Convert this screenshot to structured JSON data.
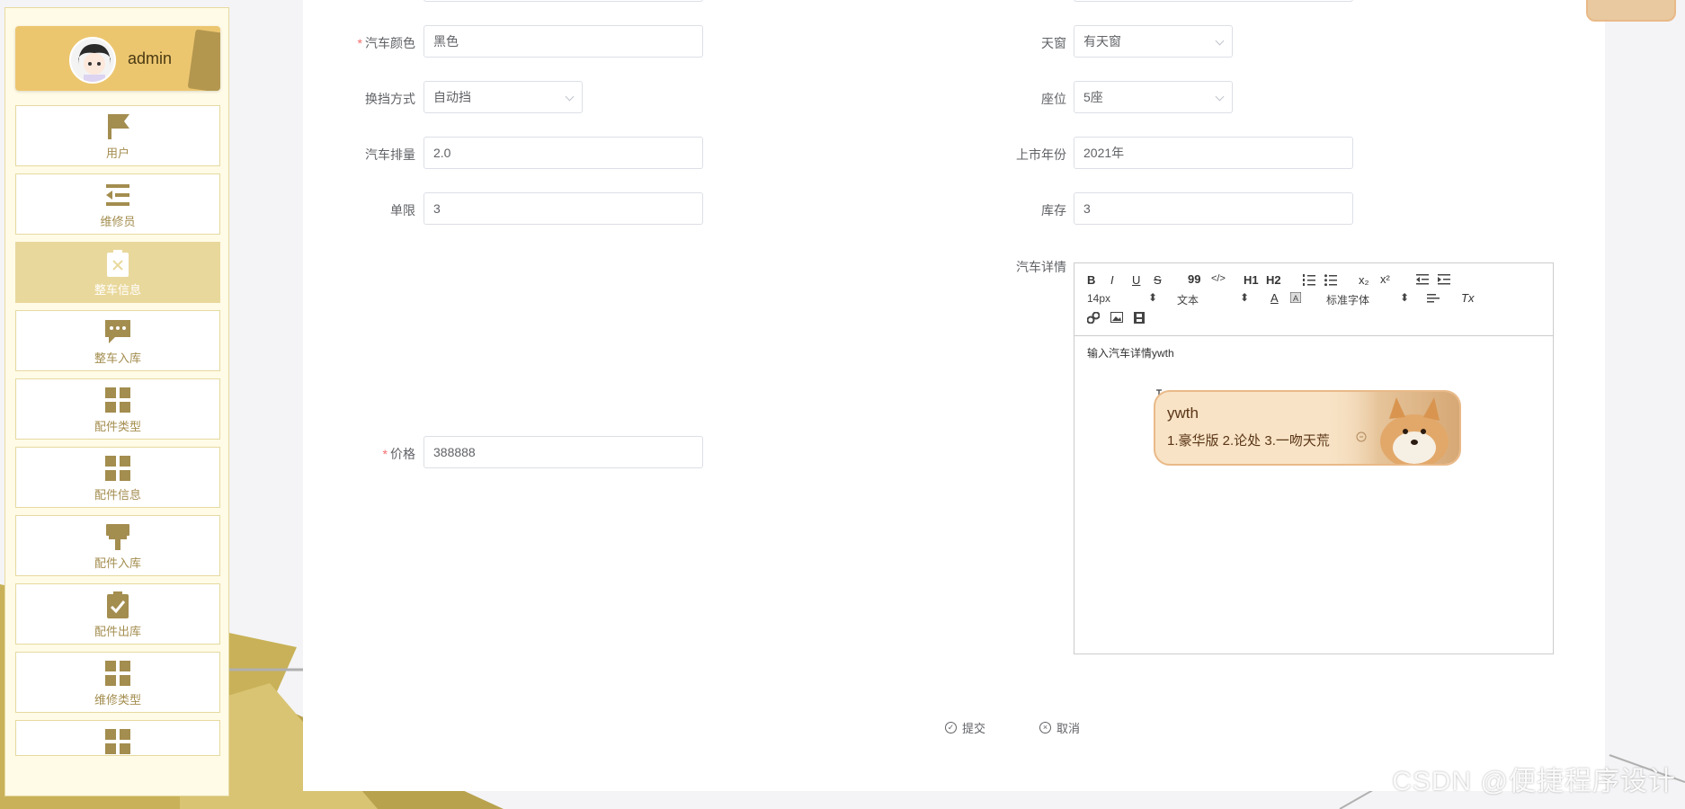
{
  "sidebar": {
    "username": "admin",
    "items": [
      {
        "label": "用户",
        "icon": "flag-icon"
      },
      {
        "label": "维修员",
        "icon": "indent-list-icon"
      },
      {
        "label": "整车信息",
        "icon": "clipboard-x-icon"
      },
      {
        "label": "整车入库",
        "icon": "chat-bubble-icon"
      },
      {
        "label": "配件类型",
        "icon": "grid-icon"
      },
      {
        "label": "配件信息",
        "icon": "grid-icon"
      },
      {
        "label": "配件入库",
        "icon": "paint-brush-icon"
      },
      {
        "label": "配件出库",
        "icon": "clipboard-check-icon"
      },
      {
        "label": "维修类型",
        "icon": "grid-icon"
      }
    ]
  },
  "form": {
    "color": {
      "label": "汽车颜色",
      "value": "黑色"
    },
    "sunroof": {
      "label": "天窗",
      "value": "有天窗"
    },
    "gearbox": {
      "label": "换挡方式",
      "value": "自动挡"
    },
    "seats": {
      "label": "座位",
      "value": "5座"
    },
    "displacement": {
      "label": "汽车排量",
      "value": "2.0"
    },
    "year": {
      "label": "上市年份",
      "value": "2021年"
    },
    "limit": {
      "label": "单限",
      "value": "3"
    },
    "stock": {
      "label": "库存",
      "value": "3"
    },
    "details": {
      "label": "汽车详情",
      "content": "输入汽车详情ywth"
    },
    "price": {
      "label": "价格",
      "value": "388888"
    }
  },
  "editor": {
    "font_size": "14px",
    "text_type": "文本",
    "font_family": "标准字体",
    "buttons": {
      "bold": "B",
      "italic": "I",
      "underline": "U",
      "strike": "S",
      "quote": "99",
      "code": "</>",
      "h1": "H1",
      "h2": "H2",
      "sub": "x₂",
      "sup": "x²",
      "color": "A",
      "clean": "Tx"
    }
  },
  "ime": {
    "typed": "ywth",
    "candidates": "1.豪华版  2.论处  3.一吻天荒"
  },
  "actions": {
    "submit": "提交",
    "cancel": "取消"
  },
  "watermark": "CSDN @便捷程序设计",
  "colors": {
    "accent": "#ecc66f",
    "active_menu": "#e9d89c",
    "icon": "#a38d4f",
    "required": "#f56c6c"
  }
}
